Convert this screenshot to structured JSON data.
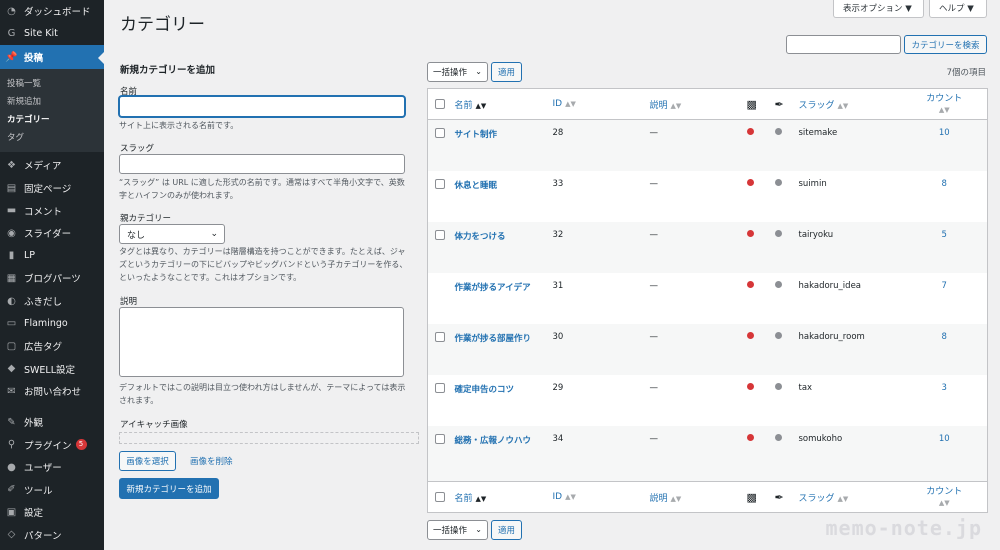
{
  "sidebar": {
    "items_top": [
      {
        "label": "ダッシュボード",
        "icon": "dashboard-icon"
      },
      {
        "label": "Site Kit",
        "icon": "google-g-icon"
      }
    ],
    "current": {
      "label": "投稿",
      "icon": "pushpin-icon"
    },
    "submenu": [
      {
        "label": "投稿一覧",
        "active": false
      },
      {
        "label": "新規追加",
        "active": false
      },
      {
        "label": "カテゴリー",
        "active": true
      },
      {
        "label": "タグ",
        "active": false
      }
    ],
    "items_mid": [
      {
        "label": "メディア",
        "icon": "media-icon"
      },
      {
        "label": "固定ページ",
        "icon": "page-icon"
      },
      {
        "label": "コメント",
        "icon": "comment-icon"
      },
      {
        "label": "スライダー",
        "icon": "slider-icon"
      },
      {
        "label": "LP",
        "icon": "lp-icon"
      },
      {
        "label": "ブログパーツ",
        "icon": "blog-parts-icon"
      },
      {
        "label": "ふきだし",
        "icon": "speech-bubble-icon"
      },
      {
        "label": "Flamingo",
        "icon": "flamingo-icon"
      },
      {
        "label": "広告タグ",
        "icon": "ad-tag-icon"
      },
      {
        "label": "SWELL設定",
        "icon": "swell-icon"
      },
      {
        "label": "お問い合わせ",
        "icon": "mail-icon"
      }
    ],
    "items_bottom": [
      {
        "label": "外観",
        "icon": "brush-icon"
      },
      {
        "label": "プラグイン",
        "icon": "plugin-icon",
        "badge": "5"
      },
      {
        "label": "ユーザー",
        "icon": "user-icon"
      },
      {
        "label": "ツール",
        "icon": "wrench-icon"
      },
      {
        "label": "設定",
        "icon": "settings-icon"
      },
      {
        "label": "パターン",
        "icon": "pattern-icon"
      }
    ]
  },
  "header": {
    "title": "カテゴリー",
    "screen_options": "表示オプション ▼",
    "help": "ヘルプ ▼"
  },
  "form": {
    "heading": "新規カテゴリーを追加",
    "name_label": "名前",
    "name_desc": "サイト上に表示される名前です。",
    "slug_label": "スラッグ",
    "slug_desc": "“スラッグ” は URL に適した形式の名前です。通常はすべて半角小文字で、英数字とハイフンのみが使われます。",
    "parent_label": "親カテゴリー",
    "parent_value": "なし",
    "parent_desc": "タグとは異なり、カテゴリーは階層構造を持つことができます。たとえば、ジャズというカテゴリーの下にビバップやビッグバンドという子カテゴリーを作る、といったようなことです。これはオプションです。",
    "desc_label": "説明",
    "desc_desc": "デフォルトではこの説明は目立つ使われ方はしませんが、テーマによっては表示されます。",
    "eyecatch_label": "アイキャッチ画像",
    "select_image": "画像を選択",
    "remove_image": "画像を削除",
    "submit": "新規カテゴリーを追加"
  },
  "list": {
    "search_button": "カテゴリーを検索",
    "bulk_action": "一括操作",
    "apply": "適用",
    "item_count": "7個の項目",
    "columns": {
      "name": "名前",
      "id": "ID",
      "desc": "説明",
      "slug": "スラッグ",
      "count": "カウント"
    },
    "rows": [
      {
        "name": "サイト制作",
        "id": "28",
        "desc": "—",
        "slug": "sitemake",
        "count": "10",
        "checkbox": true
      },
      {
        "name": "休息と睡眠",
        "id": "33",
        "desc": "—",
        "slug": "suimin",
        "count": "8",
        "checkbox": true
      },
      {
        "name": "体力をつける",
        "id": "32",
        "desc": "—",
        "slug": "tairyoku",
        "count": "5",
        "checkbox": true
      },
      {
        "name": "作業が捗るアイデア",
        "id": "31",
        "desc": "—",
        "slug": "hakadoru_idea",
        "count": "7",
        "checkbox": false
      },
      {
        "name": "作業が捗る部屋作り",
        "id": "30",
        "desc": "—",
        "slug": "hakadoru_room",
        "count": "8",
        "checkbox": true
      },
      {
        "name": "確定申告のコツ",
        "id": "29",
        "desc": "—",
        "slug": "tax",
        "count": "3",
        "checkbox": true
      },
      {
        "name": "総務・広報ノウハウ",
        "id": "34",
        "desc": "—",
        "slug": "somukoho",
        "count": "10",
        "checkbox": true
      }
    ]
  },
  "watermark": "memo-note.jp",
  "colors": {
    "accent": "#2271b1",
    "sidebar_bg": "#1d2327",
    "red_dot": "#d63638",
    "gray_dot": "#8c8f94"
  }
}
